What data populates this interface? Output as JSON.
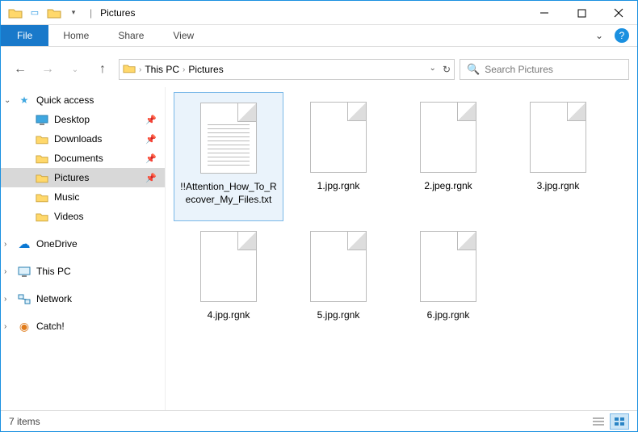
{
  "title": "Pictures",
  "ribbon": {
    "file": "File",
    "tabs": [
      "Home",
      "Share",
      "View"
    ]
  },
  "breadcrumb": [
    "This PC",
    "Pictures"
  ],
  "search": {
    "placeholder": "Search Pictures"
  },
  "sidebar": {
    "quick_access": {
      "label": "Quick access",
      "items": [
        {
          "label": "Desktop",
          "pinned": true,
          "icon": "desktop"
        },
        {
          "label": "Downloads",
          "pinned": true,
          "icon": "downloads"
        },
        {
          "label": "Documents",
          "pinned": true,
          "icon": "documents"
        },
        {
          "label": "Pictures",
          "pinned": true,
          "icon": "pictures",
          "selected": true
        },
        {
          "label": "Music",
          "pinned": false,
          "icon": "music"
        },
        {
          "label": "Videos",
          "pinned": false,
          "icon": "videos"
        }
      ]
    },
    "roots": [
      {
        "label": "OneDrive",
        "icon": "onedrive"
      },
      {
        "label": "This PC",
        "icon": "thispc"
      },
      {
        "label": "Network",
        "icon": "network"
      },
      {
        "label": "Catch!",
        "icon": "catch"
      }
    ]
  },
  "files": [
    {
      "name": "!!Attention_How_To_Recover_My_Files.txt",
      "type": "text",
      "selected": true
    },
    {
      "name": "1.jpg.rgnk",
      "type": "blank"
    },
    {
      "name": "2.jpeg.rgnk",
      "type": "blank"
    },
    {
      "name": "3.jpg.rgnk",
      "type": "blank"
    },
    {
      "name": "4.jpg.rgnk",
      "type": "blank"
    },
    {
      "name": "5.jpg.rgnk",
      "type": "blank"
    },
    {
      "name": "6.jpg.rgnk",
      "type": "blank"
    }
  ],
  "status": {
    "count_label": "7 items"
  }
}
